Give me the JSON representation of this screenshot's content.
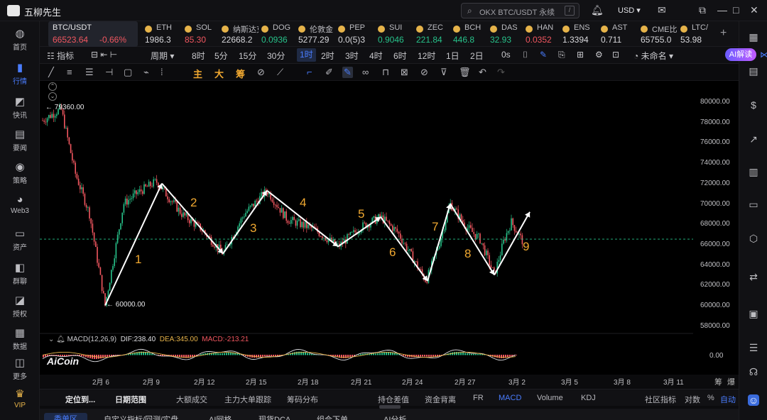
{
  "app": {
    "title": "五柳先生",
    "currency": "USD"
  },
  "search": {
    "placeholder": "OKX BTC/USDT 永续",
    "shortcut": "/"
  },
  "left_nav": [
    {
      "label": "首页",
      "icon": "home-icon"
    },
    {
      "label": "行情",
      "icon": "market-chart-icon",
      "active": true
    },
    {
      "label": "快讯",
      "icon": "news-flash-icon"
    },
    {
      "label": "要闻",
      "icon": "headline-icon"
    },
    {
      "label": "策略",
      "icon": "strategy-robot-icon"
    },
    {
      "label": "Web3",
      "icon": "web3-icon"
    },
    {
      "label": "资产",
      "icon": "wallet-icon"
    },
    {
      "label": "群聊",
      "icon": "chat-group-icon"
    },
    {
      "label": "授权",
      "icon": "authorize-icon"
    },
    {
      "label": "数据",
      "icon": "data-icon"
    },
    {
      "label": "更多",
      "icon": "more-grid-icon"
    },
    {
      "label": "VIP",
      "icon": "vip-crown-icon"
    }
  ],
  "tickers": [
    {
      "sym": "BTC/USDT",
      "price": "66523.64",
      "change": "-0.66%",
      "trend": "down",
      "main": true
    },
    {
      "sym": "ETH",
      "price": "1986.3",
      "trend": "neutral"
    },
    {
      "sym": "SOL",
      "price": "85.30",
      "trend": "down"
    },
    {
      "sym": "纳斯达克",
      "price": "22668.2",
      "trend": "neutral"
    },
    {
      "sym": "DOG",
      "price": "0.0936",
      "trend": "up"
    },
    {
      "sym": "伦敦金",
      "price": "5277.29",
      "trend": "neutral"
    },
    {
      "sym": "PEP",
      "price": "0.0(5)3",
      "trend": "neutral"
    },
    {
      "sym": "SUI",
      "price": "0.9046",
      "trend": "up"
    },
    {
      "sym": "ZEC",
      "price": "221.84",
      "trend": "up"
    },
    {
      "sym": "BCH",
      "price": "446.8",
      "trend": "up"
    },
    {
      "sym": "DAS",
      "price": "32.93",
      "trend": "up"
    },
    {
      "sym": "HAN",
      "price": "0.0352",
      "trend": "down"
    },
    {
      "sym": "ENS",
      "price": "1.3394",
      "trend": "neutral"
    },
    {
      "sym": "AST",
      "price": "0.711",
      "trend": "neutral"
    },
    {
      "sym": "CME比特",
      "price": "65755.0",
      "trend": "neutral"
    },
    {
      "sym": "LTC/",
      "price": "53.98",
      "trend": "neutral"
    }
  ],
  "toolbar1": {
    "indicator": "指标",
    "period": "周期",
    "intervals": [
      "8时",
      "5分",
      "15分",
      "30分",
      "1时",
      "2时",
      "3时",
      "4时",
      "6时",
      "12时",
      "1日",
      "2日",
      "0s"
    ],
    "active_interval": "1时",
    "unnamed": "未命名",
    "ai_button": "AI解读"
  },
  "toolbar2": {
    "chars": [
      "主",
      "大",
      "筹"
    ]
  },
  "chart": {
    "price_axis": [
      "80000.00",
      "78000.00",
      "76000.00",
      "74000.00",
      "72000.00",
      "70000.00",
      "68000.00",
      "66000.00",
      "64000.00",
      "62000.00",
      "60000.00",
      "58000.00"
    ],
    "dates": [
      "2月 6",
      "2月 9",
      "2月 12",
      "2月 15",
      "2月 18",
      "2月 21",
      "2月 24",
      "2月 27",
      "3月 2",
      "3月 5",
      "3月 8",
      "3月 11"
    ],
    "high_annotation": "79360.00",
    "low_annotation": "60000.00",
    "current_price": 66523.64,
    "wave_labels": [
      "1",
      "2",
      "3",
      "4",
      "5",
      "6",
      "7",
      "8",
      "9"
    ],
    "macd": {
      "label": "MACD(12,26,9)",
      "dif": "DIF:238.40",
      "dea": "DEA:345.00",
      "macd": "MACD:-213.21",
      "zero": "0.00"
    },
    "watermark": "AiCoin",
    "corner_labels": [
      "筹",
      "爆"
    ]
  },
  "bottom_tabs": {
    "items": [
      "定位到...",
      "日期范围",
      "大额成交",
      "主力大单跟踪",
      "筹码分布",
      "持仓差值",
      "资金背离",
      "FR",
      "MACD",
      "Volume",
      "KDJ",
      "社区指标",
      "对数",
      "%",
      "自动"
    ],
    "active": "MACD"
  },
  "bottom_tabs2": {
    "items": [
      "委单区",
      "自定义指标/回测/实盘",
      "AI网格",
      "现货DCA",
      "组合下单",
      "AI分析"
    ],
    "active": "委单区"
  }
}
